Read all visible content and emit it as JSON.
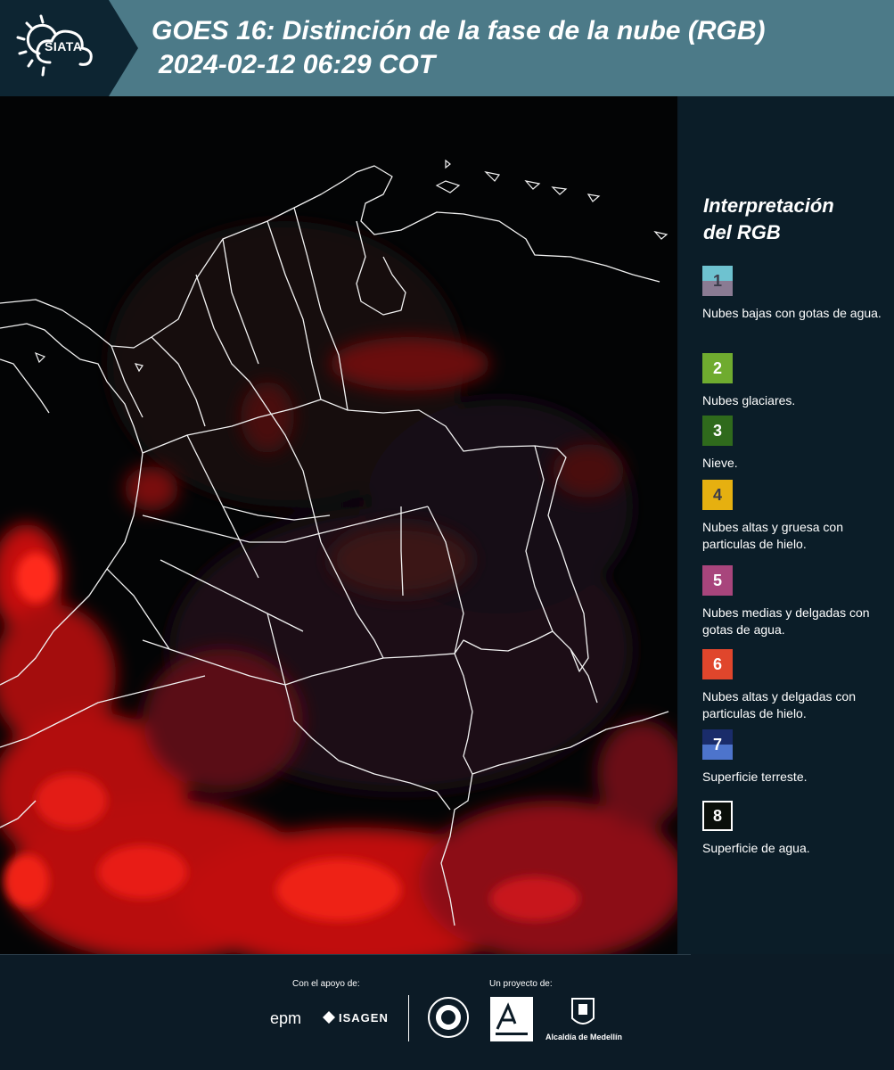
{
  "header": {
    "logo_text": "SIATA",
    "title_line1": "GOES 16: Distinción de la fase de la nube (RGB)",
    "title_line2": "2024-02-12 06:29 COT"
  },
  "legend": {
    "title_line1": "Interpretación",
    "title_line2": "del RGB",
    "items": [
      {
        "number": "1",
        "label": "Nubes bajas con gotas de agua.",
        "color_top": "#6ec2d0",
        "color_bottom": "#8a7b93",
        "text_color": "#3b3b4a"
      },
      {
        "number": "2",
        "label": "Nubes glaciares.",
        "color_top": "#6fab2f",
        "color_bottom": "#6fab2f",
        "text_color": "#ffffff"
      },
      {
        "number": "3",
        "label": "Nieve.",
        "color_top": "#2f6a1c",
        "color_bottom": "#2f6a1c",
        "text_color": "#ffffff"
      },
      {
        "number": "4",
        "label": "Nubes altas y gruesa con particulas de hielo.",
        "color_top": "#e6b010",
        "color_bottom": "#e6b010",
        "text_color": "#3b3b4a"
      },
      {
        "number": "5",
        "label": "Nubes medias y delgadas con gotas de agua.",
        "color_top": "#a8457c",
        "color_bottom": "#a8457c",
        "text_color": "#ffffff"
      },
      {
        "number": "6",
        "label": "Nubes altas y delgadas con particulas de hielo.",
        "color_top": "#e0462c",
        "color_bottom": "#e0462c",
        "text_color": "#ffffff"
      },
      {
        "number": "7",
        "label": "Superficie terreste.",
        "color_top": "#1a2c6a",
        "color_bottom": "#4d74cc",
        "text_color": "#ffffff"
      },
      {
        "number": "8",
        "label": "Superficie de agua.",
        "color_top": "#0a0f0a",
        "color_bottom": "#0a0f0a",
        "text_color": "#ffffff",
        "border": "#ffffff"
      }
    ]
  },
  "footer": {
    "support_label": "Con el apoyo de:",
    "project_label": "Un proyecto de:",
    "sponsors": [
      "epm",
      "ISAGEN"
    ],
    "partners": [
      "Área Metropolitana Valle de Aburrá",
      "Alcaldía de Medellín"
    ]
  },
  "colors": {
    "header_bg": "#4c7a88",
    "legend_bg": "#0b1d28",
    "cloud_red": "#e01010"
  }
}
